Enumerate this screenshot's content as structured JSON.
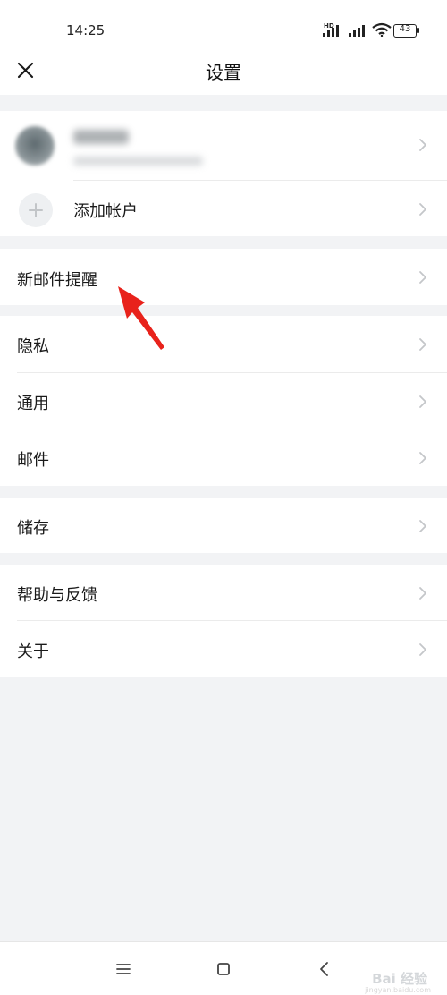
{
  "status_bar": {
    "time": "14:25",
    "network_label": "HD",
    "battery": "43"
  },
  "header": {
    "title": "设置"
  },
  "account": {
    "add_account_label": "添加帐户"
  },
  "menu": {
    "new_mail_alert": "新邮件提醒",
    "privacy": "隐私",
    "general": "通用",
    "mail": "邮件",
    "storage": "储存",
    "help_feedback": "帮助与反馈",
    "about": "关于"
  },
  "annotation": {
    "arrow_color": "#e8221b"
  },
  "watermark": {
    "text": "Bai 经验",
    "sub": "jingyan.baidu.com"
  },
  "colors": {
    "background": "#f2f3f5",
    "surface": "#ffffff",
    "text": "#1a1a1a",
    "chevron": "#c4c6c9"
  }
}
